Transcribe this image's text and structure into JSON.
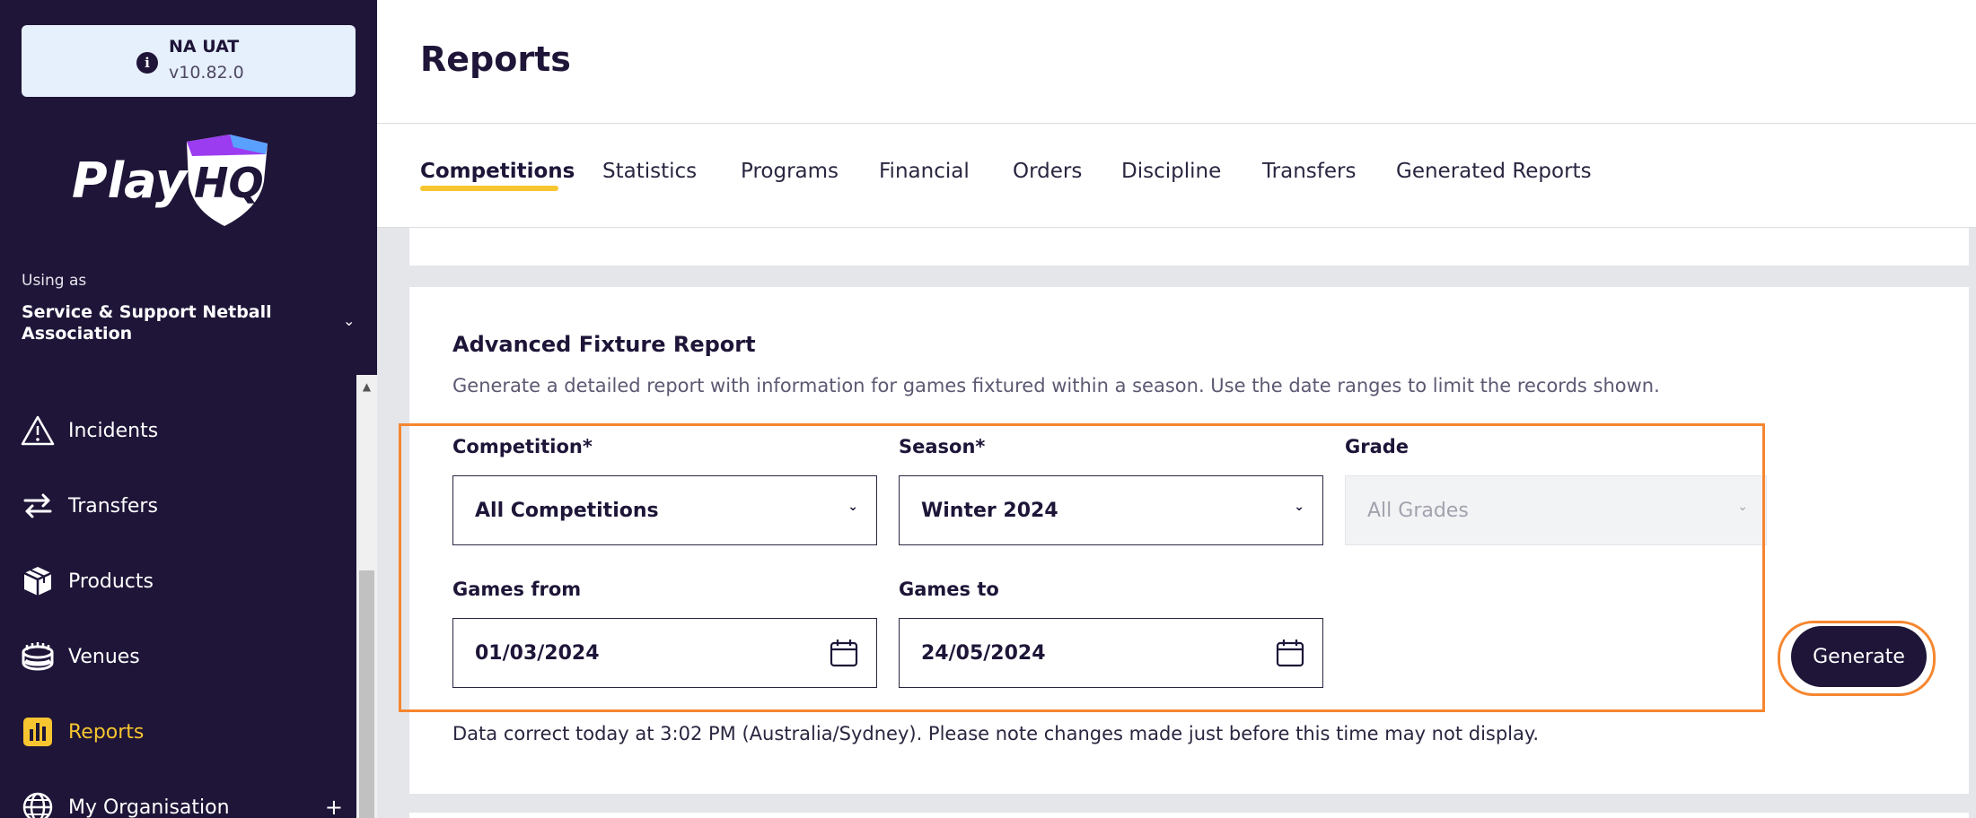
{
  "environment": {
    "name": "NA UAT",
    "version": "v10.82.0"
  },
  "brand": {
    "logo_text_play": "Play",
    "logo_text_hq": "HQ"
  },
  "account": {
    "using_as_label": "Using as",
    "org_name": "Service & Support Netball Association"
  },
  "sidebar": {
    "items": [
      {
        "label": "Incidents",
        "icon": "warning-icon",
        "active": false
      },
      {
        "label": "Transfers",
        "icon": "transfer-arrows-icon",
        "active": false
      },
      {
        "label": "Products",
        "icon": "box-icon",
        "active": false
      },
      {
        "label": "Venues",
        "icon": "stadium-icon",
        "active": false
      },
      {
        "label": "Reports",
        "icon": "bar-chart-icon",
        "active": true
      },
      {
        "label": "My Organisation",
        "icon": "globe-icon",
        "active": false,
        "expand": "+"
      }
    ]
  },
  "header": {
    "title": "Reports"
  },
  "tabs": [
    {
      "label": "Competitions",
      "active": true
    },
    {
      "label": "Statistics"
    },
    {
      "label": "Programs"
    },
    {
      "label": "Financial"
    },
    {
      "label": "Orders"
    },
    {
      "label": "Discipline"
    },
    {
      "label": "Transfers"
    },
    {
      "label": "Generated Reports"
    }
  ],
  "report": {
    "title": "Advanced Fixture Report",
    "description": "Generate a detailed report with information for games fixtured within a season. Use the date ranges to limit the records shown.",
    "competition": {
      "label": "Competition*",
      "value": "All Competitions"
    },
    "season": {
      "label": "Season*",
      "value": "Winter 2024"
    },
    "grade": {
      "label": "Grade",
      "value": "All Grades"
    },
    "games_from": {
      "label": "Games from",
      "value": "01/03/2024"
    },
    "games_to": {
      "label": "Games to",
      "value": "24/05/2024"
    },
    "generate_label": "Generate",
    "note": "Data correct today at 3:02 PM (Australia/Sydney). Please note changes made just before this time may not display."
  },
  "colors": {
    "sidebar_bg": "#1e1538",
    "accent": "#f7c530",
    "highlight": "#f5862f"
  }
}
